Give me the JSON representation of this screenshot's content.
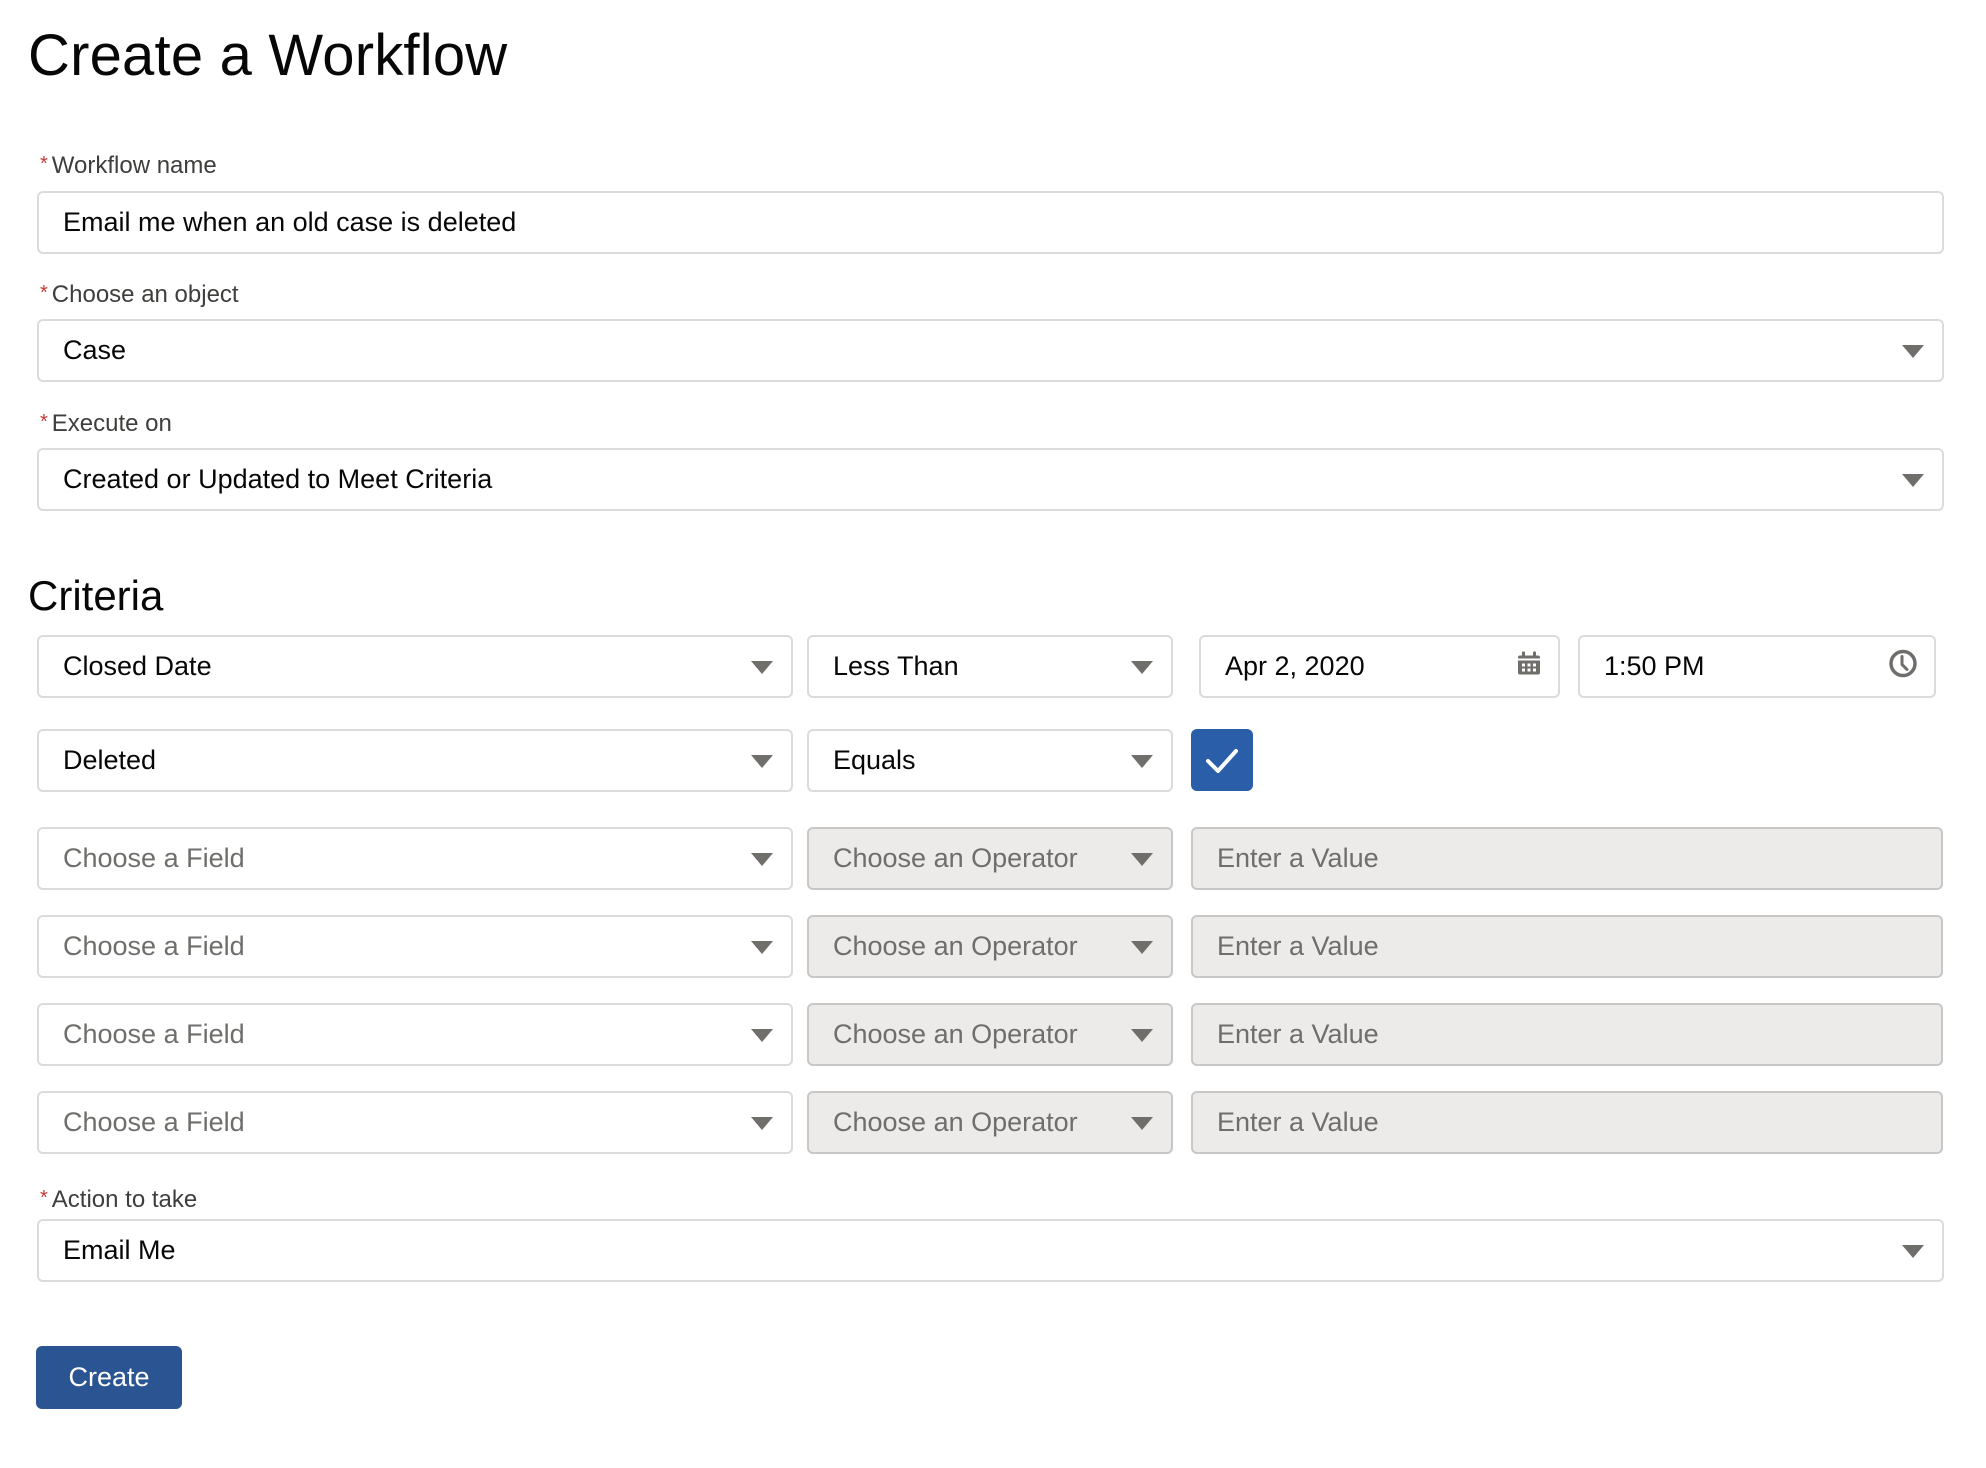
{
  "page": {
    "title": "Create a Workflow"
  },
  "form": {
    "required_marker": "*",
    "workflow_name": {
      "label": "Workflow name",
      "value": "Email me when an old case is deleted"
    },
    "object": {
      "label": "Choose an object",
      "value": "Case"
    },
    "execute_on": {
      "label": "Execute on",
      "value": "Created or Updated to Meet Criteria"
    },
    "criteria": {
      "title": "Criteria",
      "rows": [
        {
          "field": "Closed Date",
          "operator": "Less Than",
          "date": "Apr 2, 2020",
          "time": "1:50 PM"
        },
        {
          "field": "Deleted",
          "operator": "Equals",
          "checked": true
        },
        {
          "field_placeholder": "Choose a Field",
          "operator_placeholder": "Choose an Operator",
          "value_placeholder": "Enter a Value"
        },
        {
          "field_placeholder": "Choose a Field",
          "operator_placeholder": "Choose an Operator",
          "value_placeholder": "Enter a Value"
        },
        {
          "field_placeholder": "Choose a Field",
          "operator_placeholder": "Choose an Operator",
          "value_placeholder": "Enter a Value"
        },
        {
          "field_placeholder": "Choose a Field",
          "operator_placeholder": "Choose an Operator",
          "value_placeholder": "Enter a Value"
        }
      ]
    },
    "action": {
      "label": "Action to take",
      "value": "Email Me"
    },
    "create_label": "Create"
  },
  "colors": {
    "primary_button": "#2b5592",
    "checkbox_checked": "#2a5ea8",
    "required": "#c23934",
    "disabled_bg": "#ecebea"
  }
}
